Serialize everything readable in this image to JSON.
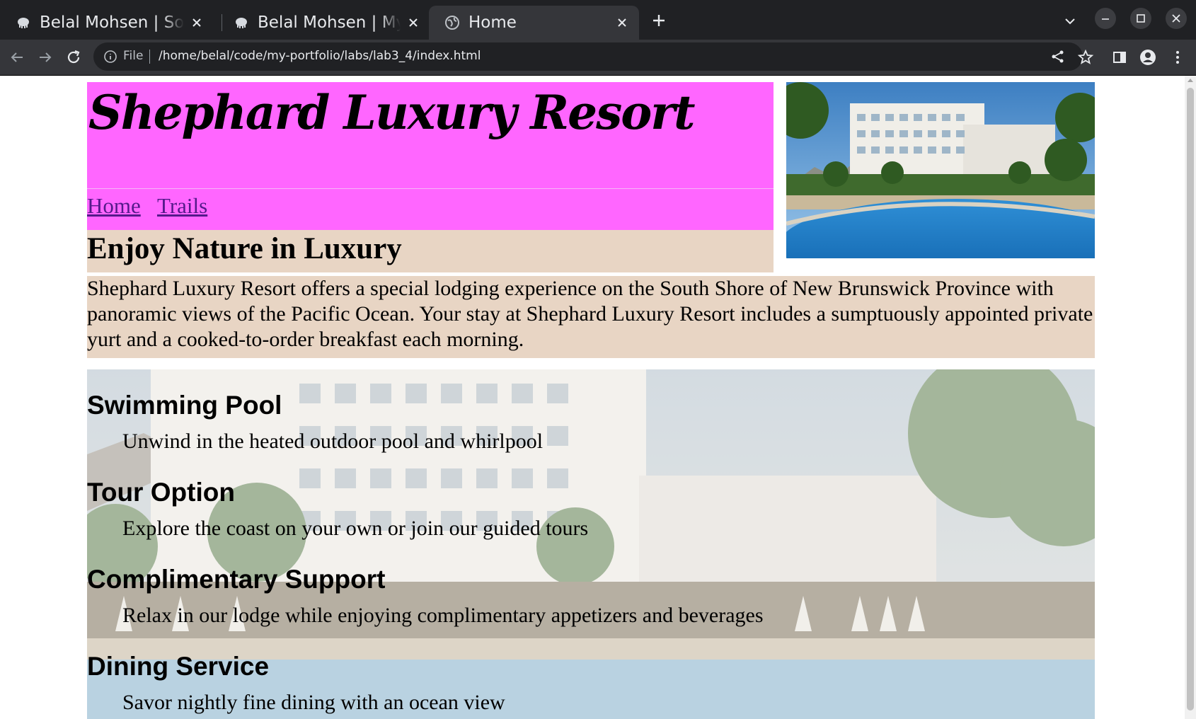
{
  "browser": {
    "tabs": [
      {
        "title": "Belal Mohsen | Software Engineer",
        "active": false
      },
      {
        "title": "Belal Mohsen | My Labs",
        "active": false
      },
      {
        "title": "Home",
        "active": true
      }
    ],
    "address_bar": {
      "scheme_label": "File",
      "url": "/home/belal/code/my-portfolio/labs/lab3_4/index.html"
    }
  },
  "page": {
    "site_title": "Shephard Luxury Resort",
    "nav": [
      {
        "label": "Home"
      },
      {
        "label": "Trails"
      }
    ],
    "intro_heading": "Enjoy Nature in Luxury",
    "intro_text": "Shephard Luxury Resort offers a special lodging experience on the South Shore of New Brunswick Province with panoramic views of the Pacific Ocean. Your stay at Shephard Luxury Resort includes a sumptuously appointed private yurt and a cooked-to-order breakfast each morning.",
    "amenities": [
      {
        "title": "Swimming Pool",
        "description": "Unwind in the heated outdoor pool and whirlpool"
      },
      {
        "title": "Tour Option",
        "description": "Explore the coast on your own or join our guided tours"
      },
      {
        "title": "Complimentary Support",
        "description": "Relax in our lodge while enjoying complimentary appetizers and beverages"
      },
      {
        "title": "Dining Service",
        "description": "Savor nightly fine dining with an ocean view"
      }
    ]
  },
  "colors": {
    "header_bg": "#ff66ff",
    "intro_bg": "#e8d5c4",
    "link": "#551a8b",
    "chrome_dark": "#202124",
    "chrome_toolbar": "#35363a"
  }
}
